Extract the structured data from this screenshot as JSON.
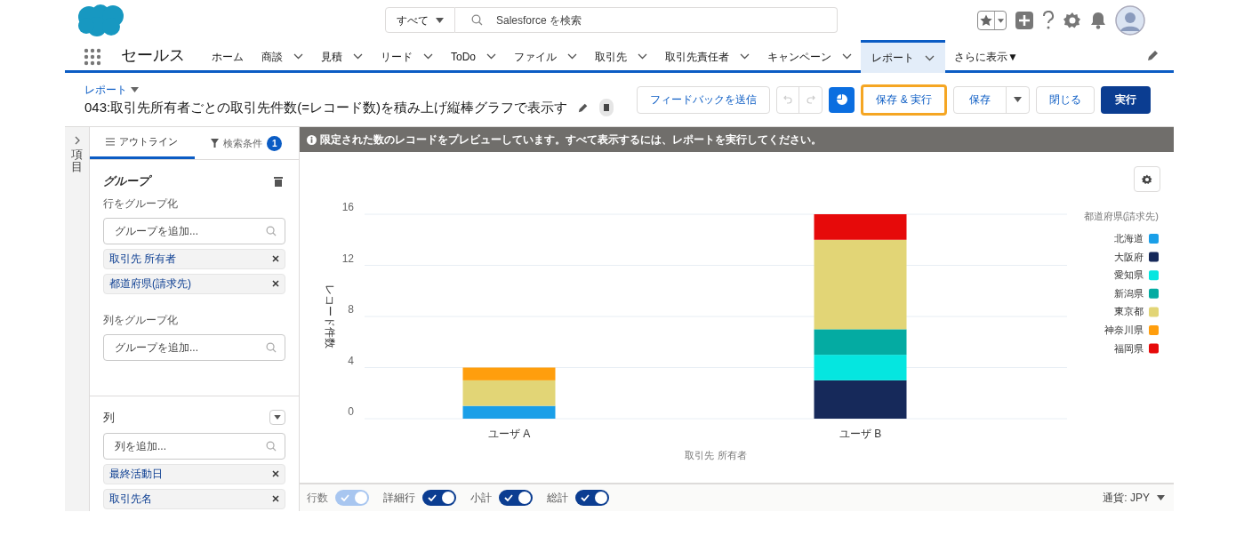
{
  "header": {
    "search_scope": "すべて",
    "search_placeholder": "Salesforce を検索"
  },
  "app_name": "セールス",
  "nav": [
    {
      "label": "ホーム",
      "caret": false,
      "selected": false
    },
    {
      "label": "商談",
      "caret": true,
      "selected": false
    },
    {
      "label": "見積",
      "caret": true,
      "selected": false
    },
    {
      "label": "リード",
      "caret": true,
      "selected": false
    },
    {
      "label": "ToDo",
      "caret": true,
      "selected": false
    },
    {
      "label": "ファイル",
      "caret": true,
      "selected": false
    },
    {
      "label": "取引先",
      "caret": true,
      "selected": false
    },
    {
      "label": "取引先責任者",
      "caret": true,
      "selected": false
    },
    {
      "label": "キャンペーン",
      "caret": true,
      "selected": false
    },
    {
      "label": "レポート",
      "caret": true,
      "selected": true
    },
    {
      "label": "さらに表示▼",
      "caret": false,
      "selected": false
    }
  ],
  "report": {
    "breadcrumb": "レポート",
    "title": "043:取引先所有者ごとの取引先件数(=レコード数)を積み上げ縦棒グラフで表示す"
  },
  "actions": [
    {
      "kind": "outline",
      "label": "フィードバックを送信",
      "highlighted": false
    },
    {
      "kind": "undo_redo"
    },
    {
      "kind": "chart_toggle"
    },
    {
      "kind": "outline",
      "label": "保存 & 実行",
      "highlighted": true
    },
    {
      "kind": "split",
      "label": "保存"
    },
    {
      "kind": "outline",
      "label": "閉じる",
      "highlighted": false
    },
    {
      "kind": "brand",
      "label": "実行"
    }
  ],
  "sidebar": {
    "label": "項目"
  },
  "panel_tabs": [
    {
      "label": "アウトライン",
      "selected": true
    },
    {
      "label": "検索条件",
      "selected": false,
      "count": "1"
    }
  ],
  "groups": {
    "title": "グループ",
    "rows_label": "行をグループ化",
    "rows_placeholder": "グループを追加...",
    "row_groups": [
      "取引先 所有者",
      "都道府県(請求先)"
    ],
    "cols_label": "列をグループ化",
    "cols_placeholder": "グループを追加..."
  },
  "columns": {
    "title": "列",
    "placeholder": "列を追加...",
    "items": [
      "最終活動日",
      "取引先名"
    ]
  },
  "banner": "限定された数のレコードをプレビューしています。すべて表示するには、レポートを実行してください。",
  "chart_data": {
    "type": "bar",
    "stacked": true,
    "orientation": "vertical",
    "grid": true,
    "legend": {
      "title": "都道府県(請求先)"
    },
    "xlabel": "取引先 所有者",
    "ylabel": "レコード件数",
    "categories": [
      "ユーザ A",
      "ユーザ B"
    ],
    "ylim": [
      0,
      16
    ],
    "yticks": [
      0,
      4,
      8,
      12,
      16
    ],
    "series": [
      {
        "name": "北海道",
        "color": "#1a9fe8",
        "values": [
          1,
          0
        ]
      },
      {
        "name": "大阪府",
        "color": "#16295a",
        "values": [
          0,
          3
        ]
      },
      {
        "name": "愛知県",
        "color": "#05e6e0",
        "values": [
          0,
          2
        ]
      },
      {
        "name": "新潟県",
        "color": "#04aba2",
        "values": [
          0,
          2
        ]
      },
      {
        "name": "東京都",
        "color": "#e2d576",
        "values": [
          2,
          7
        ]
      },
      {
        "name": "神奈川県",
        "color": "#ff9e0d",
        "values": [
          1,
          0
        ]
      },
      {
        "name": "福岡県",
        "color": "#e60a0a",
        "values": [
          0,
          2
        ]
      }
    ]
  },
  "toggles": [
    {
      "label": "行数",
      "on": true,
      "disabled": true
    },
    {
      "label": "詳細行",
      "on": true,
      "disabled": false
    },
    {
      "label": "小計",
      "on": true,
      "disabled": false
    },
    {
      "label": "総計",
      "on": true,
      "disabled": false
    }
  ],
  "currency": "通貨: JPY"
}
